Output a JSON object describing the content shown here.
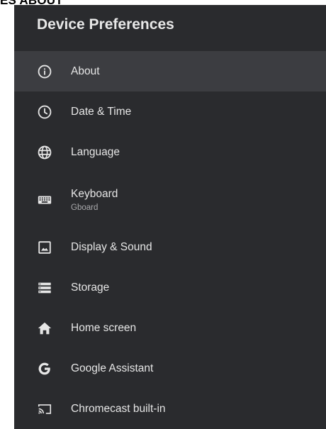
{
  "caption": "ES ABOUT",
  "panel": {
    "title": "Device Preferences"
  },
  "menu": {
    "items": [
      {
        "label": "About",
        "icon": "info-icon",
        "selected": true
      },
      {
        "label": "Date & Time",
        "icon": "clock-icon"
      },
      {
        "label": "Language",
        "icon": "globe-icon"
      },
      {
        "label": "Keyboard",
        "sublabel": "Gboard",
        "icon": "keyboard-icon"
      },
      {
        "label": "Display & Sound",
        "icon": "image-icon"
      },
      {
        "label": "Storage",
        "icon": "storage-icon"
      },
      {
        "label": "Home screen",
        "icon": "home-icon"
      },
      {
        "label": "Google Assistant",
        "icon": "google-icon"
      },
      {
        "label": "Chromecast built-in",
        "icon": "cast-icon"
      }
    ]
  },
  "colors": {
    "panel_background": "#2a2b2e",
    "selected_background": "#3c3d41",
    "text": "#e6e6e6",
    "subtext": "#a9a9ac"
  }
}
